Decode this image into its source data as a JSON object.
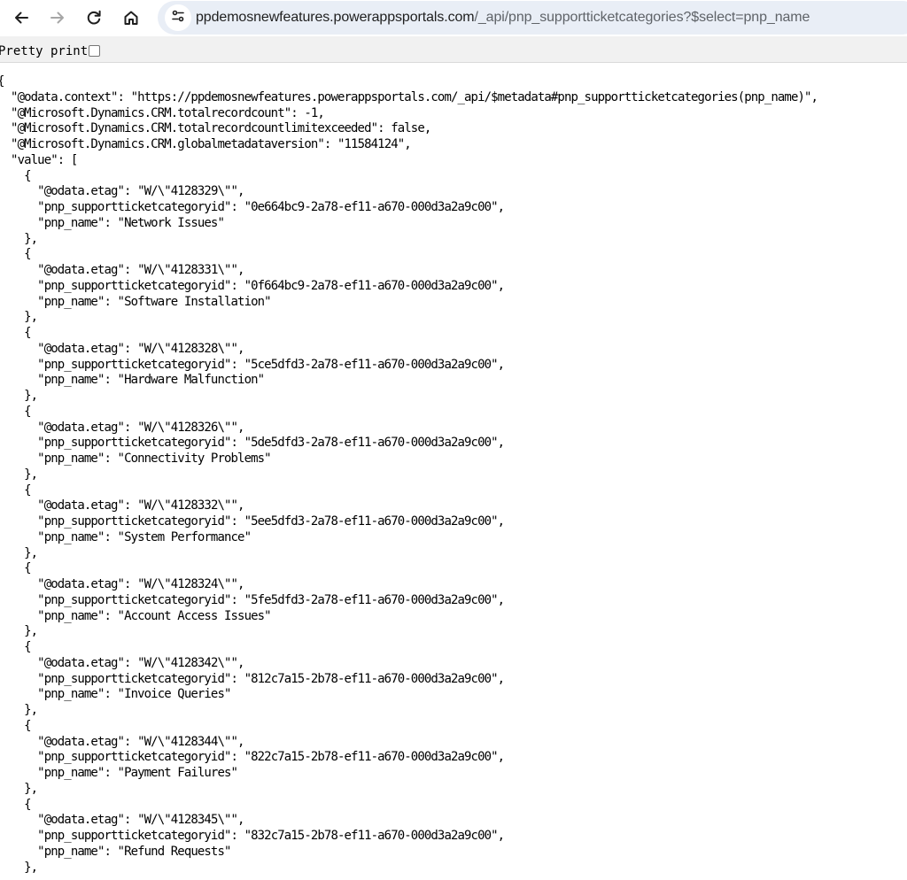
{
  "browser": {
    "url_host": "ppdemosnewfeatures.powerappsportals.com",
    "url_path": "/_api/pnp_supportticketcategories?$select=pnp_name"
  },
  "pretty_print": {
    "label": "Pretty print",
    "checked": false
  },
  "json": {
    "context_key": "@odata.context",
    "context_value": "https://ppdemosnewfeatures.powerappsportals.com/_api/$metadata#pnp_supportticketcategories(pnp_name)",
    "totalrecordcount_key": "@Microsoft.Dynamics.CRM.totalrecordcount",
    "totalrecordcount_value": "-1",
    "limitexceeded_key": "@Microsoft.Dynamics.CRM.totalrecordcountlimitexceeded",
    "limitexceeded_value": "false",
    "metadataversion_key": "@Microsoft.Dynamics.CRM.globalmetadataversion",
    "metadataversion_value": "11584124",
    "value_key": "value",
    "etag_key": "@odata.etag",
    "id_key": "pnp_supportticketcategoryid",
    "name_key": "pnp_name",
    "records": [
      {
        "etag": "W/\\\"4128329\\\"",
        "id": "0e664bc9-2a78-ef11-a670-000d3a2a9c00",
        "name": "Network Issues"
      },
      {
        "etag": "W/\\\"4128331\\\"",
        "id": "0f664bc9-2a78-ef11-a670-000d3a2a9c00",
        "name": "Software Installation"
      },
      {
        "etag": "W/\\\"4128328\\\"",
        "id": "5ce5dfd3-2a78-ef11-a670-000d3a2a9c00",
        "name": "Hardware Malfunction"
      },
      {
        "etag": "W/\\\"4128326\\\"",
        "id": "5de5dfd3-2a78-ef11-a670-000d3a2a9c00",
        "name": "Connectivity Problems"
      },
      {
        "etag": "W/\\\"4128332\\\"",
        "id": "5ee5dfd3-2a78-ef11-a670-000d3a2a9c00",
        "name": "System Performance"
      },
      {
        "etag": "W/\\\"4128324\\\"",
        "id": "5fe5dfd3-2a78-ef11-a670-000d3a2a9c00",
        "name": "Account Access Issues"
      },
      {
        "etag": "W/\\\"4128342\\\"",
        "id": "812c7a15-2b78-ef11-a670-000d3a2a9c00",
        "name": "Invoice Queries"
      },
      {
        "etag": "W/\\\"4128344\\\"",
        "id": "822c7a15-2b78-ef11-a670-000d3a2a9c00",
        "name": "Payment Failures"
      },
      {
        "etag": "W/\\\"4128345\\\"",
        "id": "832c7a15-2b78-ef11-a670-000d3a2a9c00",
        "name": "Refund Requests"
      }
    ]
  },
  "icons": {
    "back": "arrow-left-icon",
    "forward": "arrow-right-icon",
    "reload": "reload-icon",
    "home": "home-icon",
    "site_info": "tune-icon"
  },
  "colors": {
    "omnibox_bg": "#e9eef6",
    "toolbar_bg": "#ffffff",
    "pretty_bar_bg": "#f1f1f1",
    "url_host": "#1f1f1f",
    "url_path": "#5f6368",
    "forward_disabled": "#a6a6a6"
  }
}
